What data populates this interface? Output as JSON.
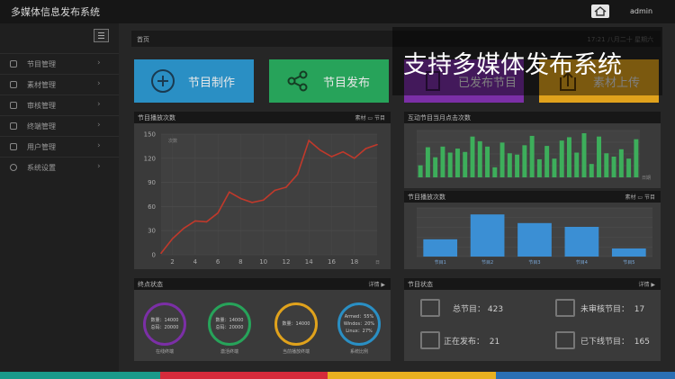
{
  "app": {
    "title": "多媒体信息发布系统",
    "user": "admin"
  },
  "sidebar": {
    "items": [
      {
        "label": "节目管理"
      },
      {
        "label": "素材管理"
      },
      {
        "label": "审核管理"
      },
      {
        "label": "终端管理"
      },
      {
        "label": "用户管理"
      },
      {
        "label": "系统设置"
      }
    ]
  },
  "breadcrumb": {
    "label": "首页",
    "time": "17:21 八月二十 星期六"
  },
  "tiles": [
    {
      "label": "节目制作",
      "color": "#2a8fc4"
    },
    {
      "label": "节目发布",
      "color": "#27a35a"
    },
    {
      "label": "已发布节目",
      "color": "#7b2fa6"
    },
    {
      "label": "素材上传",
      "color": "#e0a21c"
    }
  ],
  "caption": "支持多媒体发布系统",
  "panels": {
    "play_count": {
      "title": "节目播放次数",
      "toggle_left": "素材",
      "toggle_right": "节目"
    },
    "interaction": {
      "title": "互动节目当月点击次数",
      "xlabel": "日期"
    },
    "program_count": {
      "title": "节目播放次数",
      "toggle_left": "素材",
      "toggle_right": "节目"
    },
    "terminal": {
      "title": "终点状态",
      "more": "详情 ▶"
    },
    "program_status": {
      "title": "节目状态",
      "more": "详情 ▶"
    }
  },
  "chart_data": [
    {
      "type": "line",
      "x": [
        1,
        2,
        3,
        4,
        5,
        6,
        7,
        8,
        9,
        10,
        11,
        12,
        13,
        14,
        15,
        16,
        17,
        18,
        19,
        20
      ],
      "values": [
        2,
        20,
        33,
        42,
        41,
        52,
        78,
        70,
        65,
        68,
        80,
        84,
        100,
        142,
        130,
        122,
        128,
        120,
        132,
        137
      ],
      "ylim": [
        0,
        150
      ],
      "yticks": [
        0,
        30,
        60,
        90,
        120,
        150
      ],
      "xticks": [
        2,
        4,
        6,
        8,
        10,
        12,
        14,
        16,
        18
      ],
      "xlabel": "日",
      "ylabel": "次数",
      "color": "#c0392b"
    },
    {
      "type": "bar",
      "values": [
        18,
        45,
        30,
        46,
        37,
        43,
        38,
        61,
        54,
        46,
        15,
        52,
        36,
        34,
        48,
        62,
        27,
        47,
        28,
        55,
        60,
        37,
        66,
        20,
        61,
        36,
        31,
        42,
        28,
        57
      ],
      "color": "#3dae5b"
    },
    {
      "type": "bar",
      "categories": [
        "节目1",
        "节目2",
        "节目3",
        "节目4",
        "节目5"
      ],
      "values": [
        32,
        78,
        62,
        55,
        15
      ],
      "color": "#3b8fd4"
    }
  ],
  "terminal_status": [
    {
      "lines": [
        "数量：14000",
        "总码：20000"
      ],
      "label": "在线终端",
      "color": "#7b2fa6"
    },
    {
      "lines": [
        "数量：14000",
        "总码：20000"
      ],
      "label": "激活终端",
      "color": "#27a35a"
    },
    {
      "lines": [
        "数量：14000"
      ],
      "label": "当前播放终端",
      "color": "#e0a21c"
    },
    {
      "lines": [
        "Armed：55%",
        "Windos：20%",
        "Linux：27%"
      ],
      "label": "系统比例",
      "color": "#2a8fc4"
    }
  ],
  "program_stats": [
    {
      "label": "总节目：",
      "value": "423"
    },
    {
      "label": "未审核节目：",
      "value": "17"
    },
    {
      "label": "正在发布：",
      "value": "21"
    },
    {
      "label": "已下线节目：",
      "value": "165"
    }
  ],
  "strip_colors": [
    "#1a9a8a",
    "#d62b3b",
    "#e8b020",
    "#2a6fb4"
  ]
}
